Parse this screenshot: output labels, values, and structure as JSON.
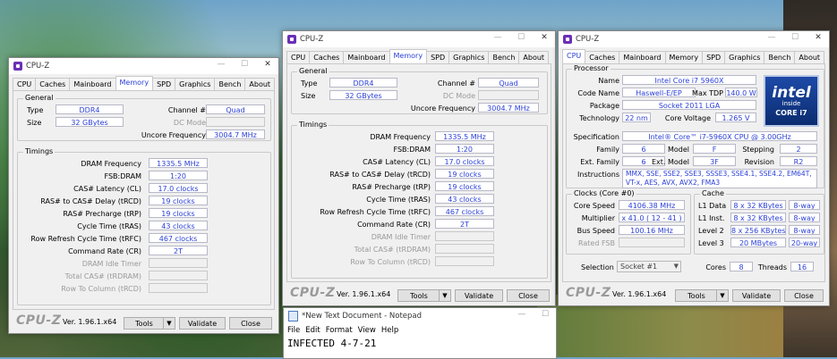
{
  "app_title": "CPU-Z",
  "tabs": [
    "CPU",
    "Caches",
    "Mainboard",
    "Memory",
    "SPD",
    "Graphics",
    "Bench",
    "About"
  ],
  "footer": {
    "logo": "CPU-Z",
    "version": "Ver. 1.96.1.x64",
    "tools": "Tools",
    "validate": "Validate",
    "close": "Close"
  },
  "memory": {
    "general_label": "General",
    "type_label": "Type",
    "type": "DDR4",
    "size_label": "Size",
    "size": "32 GBytes",
    "channel_label": "Channel #",
    "channel": "Quad",
    "dc_mode_label": "DC Mode",
    "uncore_label": "Uncore Frequency",
    "uncore": "3004.7 MHz",
    "timings_label": "Timings",
    "timings": [
      {
        "label": "DRAM Frequency",
        "value": "1335.5 MHz",
        "dim": false
      },
      {
        "label": "FSB:DRAM",
        "value": "1:20",
        "dim": false
      },
      {
        "label": "CAS# Latency (CL)",
        "value": "17.0 clocks",
        "dim": false
      },
      {
        "label": "RAS# to CAS# Delay (tRCD)",
        "value": "19 clocks",
        "dim": false
      },
      {
        "label": "RAS# Precharge (tRP)",
        "value": "19 clocks",
        "dim": false
      },
      {
        "label": "Cycle Time (tRAS)",
        "value": "43 clocks",
        "dim": false
      },
      {
        "label": "Row Refresh Cycle Time (tRFC)",
        "value": "467 clocks",
        "dim": false
      },
      {
        "label": "Command Rate (CR)",
        "value": "2T",
        "dim": false
      },
      {
        "label": "DRAM Idle Timer",
        "value": "",
        "dim": true
      },
      {
        "label": "Total CAS# (tRDRAM)",
        "value": "",
        "dim": true
      },
      {
        "label": "Row To Column (tRCD)",
        "value": "",
        "dim": true
      }
    ]
  },
  "cpu": {
    "processor_label": "Processor",
    "name_label": "Name",
    "name": "Intel Core i7 5960X",
    "codename_label": "Code Name",
    "codename": "Haswell-E/EP",
    "max_tdp_label": "Max TDP",
    "max_tdp": "140.0 W",
    "package_label": "Package",
    "package": "Socket 2011 LGA",
    "technology_label": "Technology",
    "technology": "22 nm",
    "core_voltage_label": "Core Voltage",
    "core_voltage": "1.265 V",
    "spec_label": "Specification",
    "spec": "Intel® Core™ i7-5960X CPU @ 3.00GHz",
    "family_label": "Family",
    "family": "6",
    "model_label": "Model",
    "model": "F",
    "stepping_label": "Stepping",
    "stepping": "2",
    "ext_family_label": "Ext. Family",
    "ext_family": "6",
    "ext_model_label": "Ext. Model",
    "ext_model": "3F",
    "revision_label": "Revision",
    "revision": "R2",
    "instructions_label": "Instructions",
    "instructions": "MMX, SSE, SSE2, SSE3, SSSE3, SSE4.1, SSE4.2, EM64T, VT-x, AES, AVX, AVX2, FMA3",
    "intel_logo": {
      "brand": "intel",
      "line2": "inside",
      "line3": "CORE i7"
    },
    "clocks_label": "Clocks (Core #0)",
    "core_speed_label": "Core Speed",
    "core_speed": "4106.38 MHz",
    "multiplier_label": "Multiplier",
    "multiplier": "x 41.0 ( 12 - 41 )",
    "bus_speed_label": "Bus Speed",
    "bus_speed": "100.16 MHz",
    "rated_fsb_label": "Rated FSB",
    "cache_label": "Cache",
    "caches": [
      {
        "label": "L1 Data",
        "size": "8 x 32 KBytes",
        "way": "8-way"
      },
      {
        "label": "L1 Inst.",
        "size": "8 x 32 KBytes",
        "way": "8-way"
      },
      {
        "label": "Level 2",
        "size": "8 x 256 KBytes",
        "way": "8-way"
      },
      {
        "label": "Level 3",
        "size": "20 MBytes",
        "way": "20-way"
      }
    ],
    "selection_label": "Selection",
    "selection": "Socket #1",
    "cores_label": "Cores",
    "cores": "8",
    "threads_label": "Threads",
    "threads": "16"
  },
  "notepad": {
    "title": "*New Text Document - Notepad",
    "menu": [
      "File",
      "Edit",
      "Format",
      "View",
      "Help"
    ],
    "text": "INFECTED 4-7-21"
  }
}
